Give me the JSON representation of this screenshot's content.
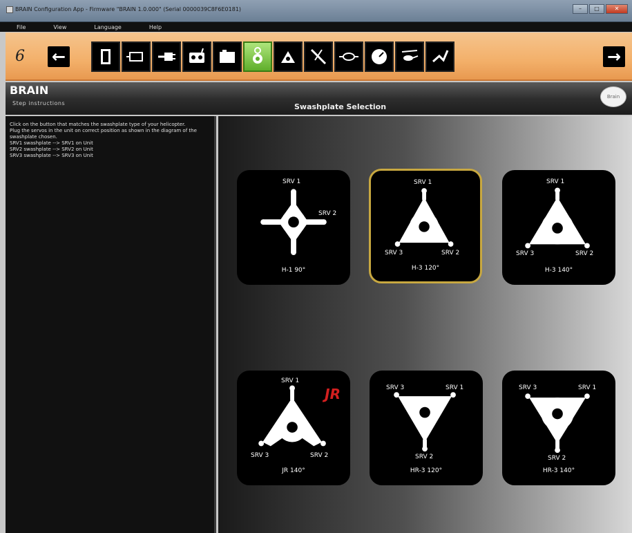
{
  "window": {
    "title": "BRAIN Configuration App - Firmware \"BRAIN 1.0.000\" (Serial 0000039C8F6E0181)",
    "controls": [
      "–",
      "□",
      "✕"
    ]
  },
  "menu": [
    "File",
    "View",
    "Language",
    "Help"
  ],
  "toolbar": {
    "step_number": "6",
    "back_icon": "←",
    "next_icon": "→",
    "steps": [
      {
        "icon": "document-icon"
      },
      {
        "icon": "receiver-icon"
      },
      {
        "icon": "plug-icon"
      },
      {
        "icon": "transmitter-icon"
      },
      {
        "icon": "box-icon"
      },
      {
        "icon": "swashplate-icon"
      },
      {
        "icon": "swash-tilt-icon"
      },
      {
        "icon": "servo-arm-icon"
      },
      {
        "icon": "link-icon"
      },
      {
        "icon": "gauge-icon"
      },
      {
        "icon": "helicopter-icon"
      },
      {
        "icon": "tail-icon"
      }
    ]
  },
  "header": {
    "brand": "BRAIN",
    "subtitle": "Step instructions",
    "page_title": "Swashplate Selection",
    "logo": "Brain"
  },
  "instructions": [
    "Click on the button that matches the swashplate type of your helicopter.",
    "Plug the servos in the unit on correct position as shown in the diagram of the swashplate chosen.",
    "SRV1 swashplate --> SRV1 on Unit",
    "SRV2 swashplate --> SRV2 on Unit",
    "SRV3 swashplate --> SRV3 on Unit"
  ],
  "swashplates": [
    {
      "name": "H-1 90°",
      "labels": [
        "SRV 1",
        "SRV 2"
      ],
      "selected": false
    },
    {
      "name": "H-3 120°",
      "labels": [
        "SRV 1",
        "SRV 3",
        "SRV 2"
      ],
      "selected": true
    },
    {
      "name": "H-3 140°",
      "labels": [
        "SRV 1",
        "SRV 3",
        "SRV 2"
      ],
      "selected": false
    },
    {
      "name": "JR 140°",
      "labels": [
        "SRV 1",
        "SRV 3",
        "SRV 2"
      ],
      "selected": false,
      "badge": "JR"
    },
    {
      "name": "HR-3 120°",
      "labels": [
        "SRV 3",
        "SRV 1",
        "SRV 2"
      ],
      "selected": false
    },
    {
      "name": "HR-3 140°",
      "labels": [
        "SRV 3",
        "SRV 1",
        "SRV 2"
      ],
      "selected": false
    }
  ]
}
